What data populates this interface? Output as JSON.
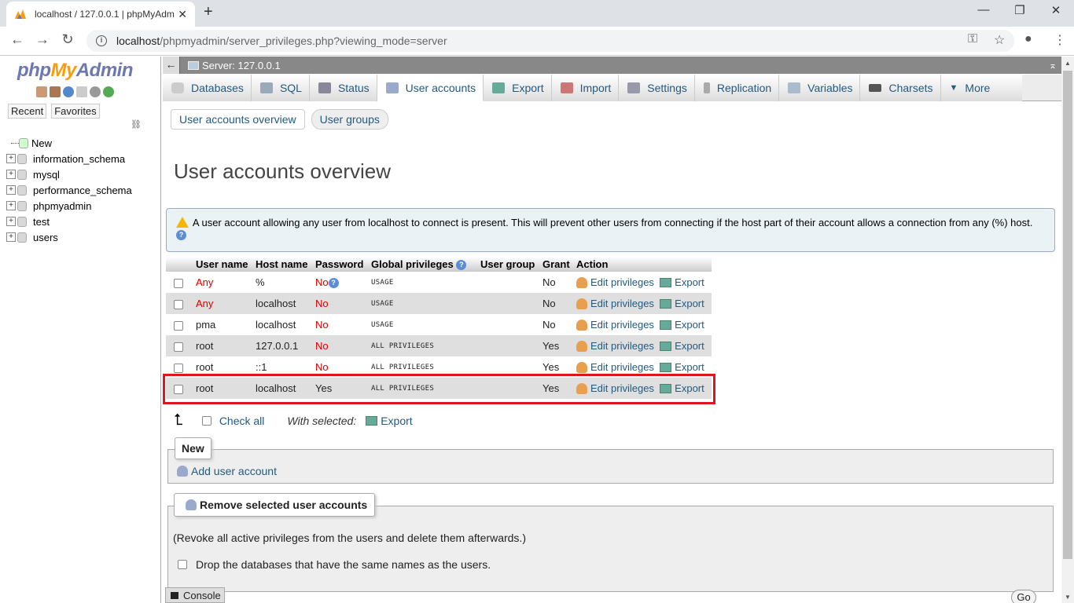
{
  "browser": {
    "tab_title": "localhost / 127.0.0.1 | phpMyAdm",
    "url_host": "localhost",
    "url_path": "/phpmyadmin/server_privileges.php?viewing_mode=server"
  },
  "sidebar": {
    "logo_php": "php",
    "logo_my": "My",
    "logo_admin": "Admin",
    "recent": "Recent",
    "favorites": "Favorites",
    "tree": [
      {
        "label": "New"
      },
      {
        "label": "information_schema"
      },
      {
        "label": "mysql"
      },
      {
        "label": "performance_schema"
      },
      {
        "label": "phpmyadmin"
      },
      {
        "label": "test"
      },
      {
        "label": "users"
      }
    ]
  },
  "server_bar": {
    "label": "Server: 127.0.0.1"
  },
  "menu": {
    "tabs": [
      {
        "label": "Databases",
        "icon": "database-icon"
      },
      {
        "label": "SQL",
        "icon": "sql-icon"
      },
      {
        "label": "Status",
        "icon": "status-icon"
      },
      {
        "label": "User accounts",
        "icon": "users-icon"
      },
      {
        "label": "Export",
        "icon": "export-icon"
      },
      {
        "label": "Import",
        "icon": "import-icon"
      },
      {
        "label": "Settings",
        "icon": "wrench-icon"
      },
      {
        "label": "Replication",
        "icon": "replication-icon"
      },
      {
        "label": "Variables",
        "icon": "variables-icon"
      },
      {
        "label": "Charsets",
        "icon": "charsets-icon"
      },
      {
        "label": "More",
        "icon": "dropdown-icon"
      }
    ],
    "active": "User accounts"
  },
  "subtabs": {
    "overview": "User accounts overview",
    "groups": "User groups"
  },
  "page_title": "User accounts overview",
  "notice": "A user account allowing any user from localhost to connect is present. This will prevent other users from connecting if the host part of their account allows a connection from any (%) host.",
  "table": {
    "headers": [
      "User name",
      "Host name",
      "Password",
      "Global privileges",
      "User group",
      "Grant",
      "Action"
    ],
    "rows": [
      {
        "user": "Any",
        "host": "%",
        "password": "No",
        "privs": "USAGE",
        "group": "",
        "grant": "No",
        "edit": "Edit privileges",
        "export": "Export"
      },
      {
        "user": "Any",
        "host": "localhost",
        "password": "No",
        "privs": "USAGE",
        "group": "",
        "grant": "No",
        "edit": "Edit privileges",
        "export": "Export"
      },
      {
        "user": "pma",
        "host": "localhost",
        "password": "No",
        "privs": "USAGE",
        "group": "",
        "grant": "No",
        "edit": "Edit privileges",
        "export": "Export"
      },
      {
        "user": "root",
        "host": "127.0.0.1",
        "password": "No",
        "privs": "ALL PRIVILEGES",
        "group": "",
        "grant": "Yes",
        "edit": "Edit privileges",
        "export": "Export"
      },
      {
        "user": "root",
        "host": "::1",
        "password": "No",
        "privs": "ALL PRIVILEGES",
        "group": "",
        "grant": "Yes",
        "edit": "Edit privileges",
        "export": "Export"
      },
      {
        "user": "root",
        "host": "localhost",
        "password": "Yes",
        "privs": "ALL PRIVILEGES",
        "group": "",
        "grant": "Yes",
        "edit": "Edit privileges",
        "export": "Export"
      }
    ]
  },
  "bulk": {
    "check_all": "Check all",
    "with_selected": "With selected:",
    "export": "Export"
  },
  "new_section": {
    "legend": "New",
    "add_user": "Add user account"
  },
  "remove_section": {
    "legend": "Remove selected user accounts",
    "revoke": "(Revoke all active privileges from the users and delete them afterwards.)",
    "drop_db": "Drop the databases that have the same names as the users."
  },
  "console": "Console",
  "go": "Go"
}
